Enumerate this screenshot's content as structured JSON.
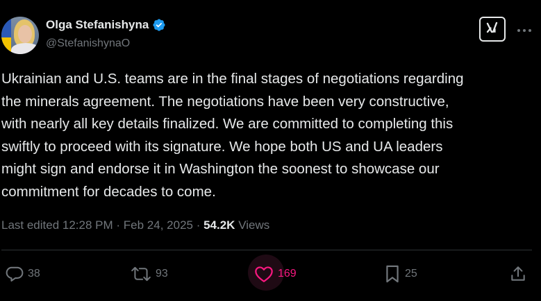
{
  "author": {
    "display_name": "Olga Stefanishyna",
    "handle": "@StefanishynaO",
    "verified": true,
    "verified_color": "#1d9bf0"
  },
  "header_actions": {
    "grok_icon": "grok-icon",
    "more_icon": "more-icon"
  },
  "tweet": {
    "text": "Ukrainian and U.S. teams are in the final stages of negotiations regarding\nthe minerals agreement. The negotiations have been very constructive,\nwith nearly all key details finalized. We are committed to completing this\nswiftly to proceed with its signature. We hope both US and UA leaders\nmight sign and endorse it in Washington the soonest to showcase our\ncommitment for decades to come."
  },
  "meta": {
    "edited_label": "Last edited 12:28 PM",
    "separator1": " · ",
    "date": "Feb 24, 2025",
    "separator2": " · ",
    "views_count": "54.2K",
    "views_label": " Views"
  },
  "actions": {
    "replies": "38",
    "reposts": "93",
    "likes": "169",
    "bookmarks": "25"
  },
  "colors": {
    "background": "#000000",
    "text": "#e7e9ea",
    "secondary": "#71767b",
    "like_active": "#f91880",
    "divider": "#2f3336"
  }
}
